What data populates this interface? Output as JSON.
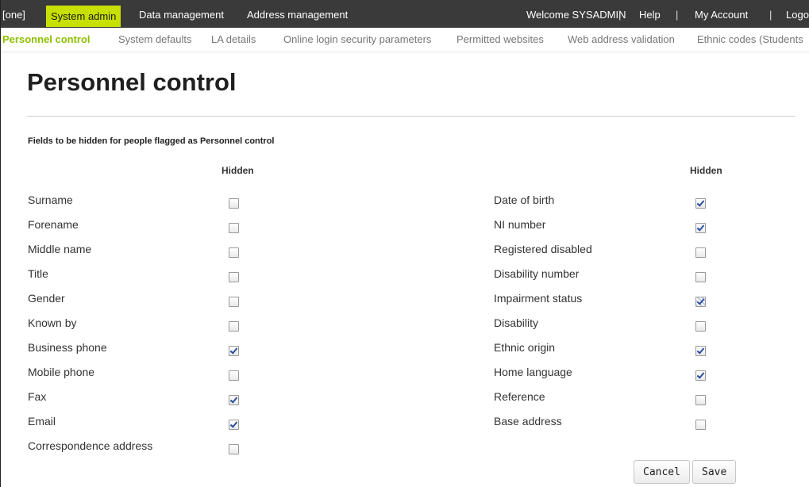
{
  "topnav": {
    "home_crumb": "[one]",
    "items": [
      "System admin",
      "Data management",
      "Address management"
    ],
    "welcome": "Welcome SYSADMIN",
    "help": "Help",
    "my_account": "My Account",
    "logout": "Logo",
    "separator": "|"
  },
  "subnav": {
    "items": [
      "Personnel control",
      "System defaults",
      "LA details",
      "Online login security parameters",
      "Permitted websites",
      "Web address validation",
      "Ethnic codes (Students"
    ]
  },
  "page": {
    "title": "Personnel control",
    "section_label": "Fields to be hidden for people flagged as Personnel control",
    "hidden_header": "Hidden"
  },
  "left_fields": [
    {
      "label": "Surname",
      "hidden": false
    },
    {
      "label": "Forename",
      "hidden": false
    },
    {
      "label": "Middle name",
      "hidden": false
    },
    {
      "label": "Title",
      "hidden": false
    },
    {
      "label": "Gender",
      "hidden": false
    },
    {
      "label": "Known by",
      "hidden": false
    },
    {
      "label": "Business phone",
      "hidden": true
    },
    {
      "label": "Mobile phone",
      "hidden": false
    },
    {
      "label": "Fax",
      "hidden": true
    },
    {
      "label": "Email",
      "hidden": true
    },
    {
      "label": "Correspondence address",
      "hidden": false
    }
  ],
  "right_fields": [
    {
      "label": "Date of birth",
      "hidden": true
    },
    {
      "label": "NI number",
      "hidden": true
    },
    {
      "label": "Registered disabled",
      "hidden": false
    },
    {
      "label": "Disability number",
      "hidden": false
    },
    {
      "label": "Impairment status",
      "hidden": "indeterminate"
    },
    {
      "label": "Disability",
      "hidden": false
    },
    {
      "label": "Ethnic origin",
      "hidden": true
    },
    {
      "label": "Home language",
      "hidden": true
    },
    {
      "label": "Reference",
      "hidden": false
    },
    {
      "label": "Base address",
      "hidden": false
    }
  ],
  "buttons": {
    "cancel": "Cancel",
    "save": "Save"
  }
}
